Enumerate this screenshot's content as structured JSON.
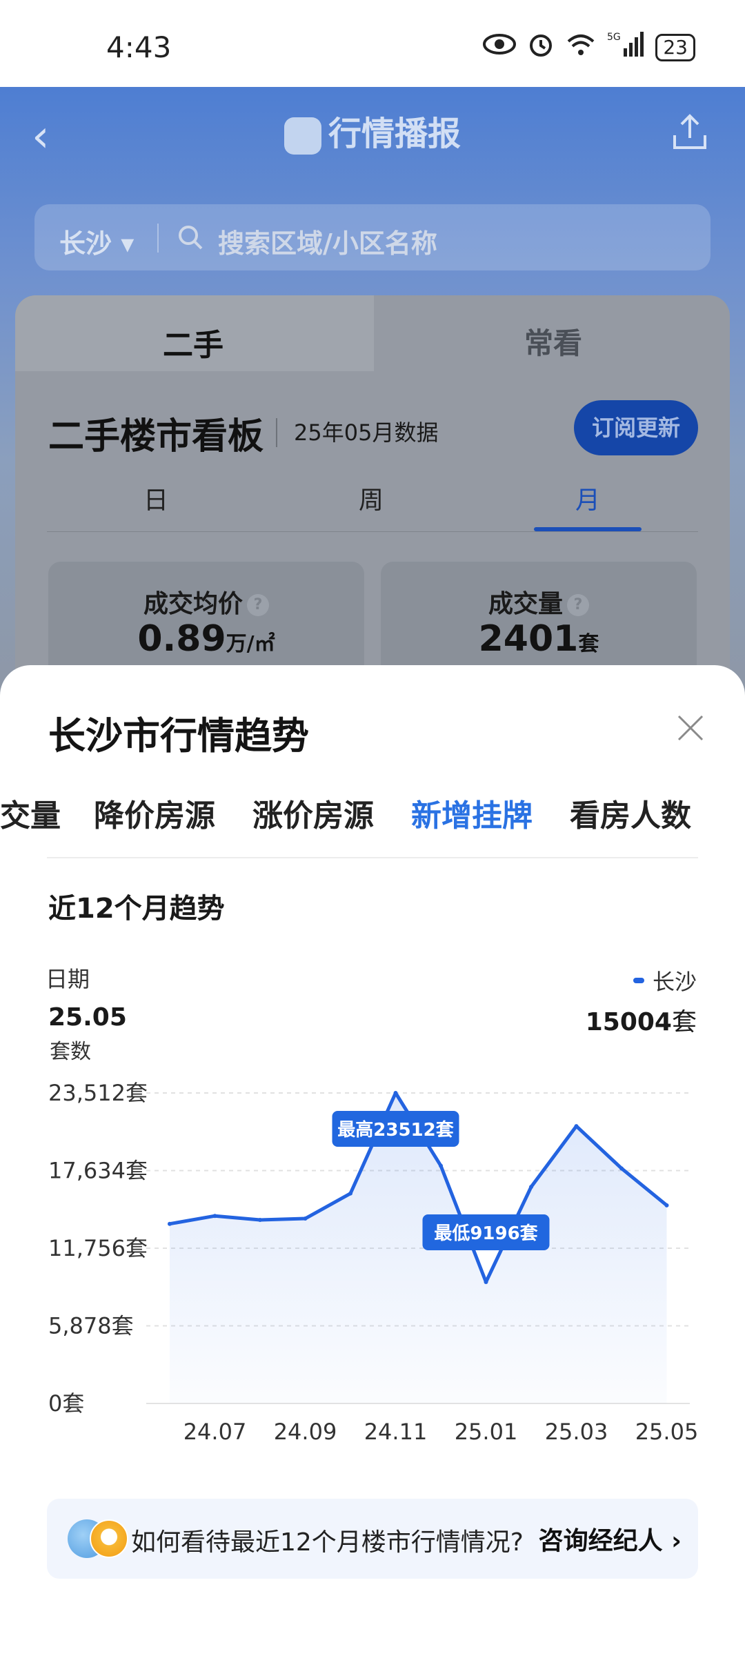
{
  "status_bar": {
    "time": "4:43",
    "network": "5G",
    "battery": "23"
  },
  "background": {
    "title": "行情播报",
    "search": {
      "city": "长沙",
      "placeholder": "搜索区域/小区名称"
    },
    "tabs": [
      "二手",
      "常看"
    ],
    "board_title": "二手楼市看板",
    "board_date": "25年05月数据",
    "subscribe": "订阅更新",
    "periods": [
      "日",
      "周",
      "月"
    ],
    "stats": [
      {
        "label": "成交均价",
        "value": "0.89",
        "unit": "万/㎡"
      },
      {
        "label": "成交量",
        "value": "2401",
        "unit": "套"
      }
    ]
  },
  "sheet": {
    "title": "长沙市行情趋势",
    "metric_tabs": [
      "交量",
      "降价房源",
      "涨价房源",
      "新增挂牌",
      "看房人数"
    ],
    "active_tab": "新增挂牌",
    "trend_title": "近12个月趋势",
    "date_label": "日期",
    "date_value": "25.05",
    "legend_name": "长沙",
    "legend_value": "15004",
    "legend_unit": "套",
    "consult_question": "如何看待最近12个月楼市行情情况?",
    "consult_link": "咨询经纪人"
  },
  "colors": {
    "accent": "#2a72e3",
    "line": "#2363e0"
  },
  "chart_data": {
    "type": "area",
    "ylabel": "套数",
    "x": [
      "24.06",
      "24.07",
      "24.08",
      "24.09",
      "24.10",
      "24.11",
      "24.12",
      "25.01",
      "25.02",
      "25.03",
      "25.04",
      "25.05"
    ],
    "x_tick_labels": [
      "24.07",
      "24.09",
      "24.11",
      "25.01",
      "25.03",
      "25.05"
    ],
    "y_ticks": [
      0,
      5878,
      11756,
      17634,
      23512
    ],
    "y_tick_labels": [
      "0套",
      "5,878套",
      "11,756套",
      "17,634套",
      "23,512套"
    ],
    "ylim": [
      0,
      23512
    ],
    "series": [
      {
        "name": "长沙",
        "values": [
          13600,
          14200,
          13900,
          14000,
          15900,
          23512,
          18000,
          9196,
          16400,
          21000,
          17800,
          15004
        ]
      }
    ],
    "annotations": [
      {
        "x": "24.11",
        "text": "最高23512套"
      },
      {
        "x": "25.01",
        "text": "最低9196套"
      }
    ],
    "grid": true
  }
}
